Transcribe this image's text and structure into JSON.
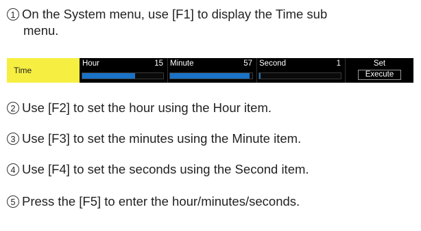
{
  "steps": [
    {
      "num": "1",
      "line1": "On the System menu, use [F1] to display the Time sub",
      "line2": "menu."
    },
    {
      "num": "2",
      "text": "Use [F2] to set the hour using the Hour item."
    },
    {
      "num": "3",
      "text": "Use [F3] to set the minutes using the Minute item."
    },
    {
      "num": "4",
      "text": "Use [F4] to set the seconds using the Second item."
    },
    {
      "num": "5",
      "text": "Press the [F5] to enter the hour/minutes/seconds."
    }
  ],
  "panel": {
    "title": "Time",
    "hour": {
      "label": "Hour",
      "value": "15",
      "fill_fraction": 0.65
    },
    "minute": {
      "label": "Minute",
      "value": "57",
      "fill_fraction": 0.97
    },
    "second": {
      "label": "Second",
      "value": "1",
      "fill_fraction": 0.02
    },
    "set": {
      "label": "Set",
      "button": "Execute"
    },
    "colors": {
      "title_bg": "#f6ef42",
      "panel_bg": "#000000",
      "bar_fill": "#1a73c6"
    }
  }
}
